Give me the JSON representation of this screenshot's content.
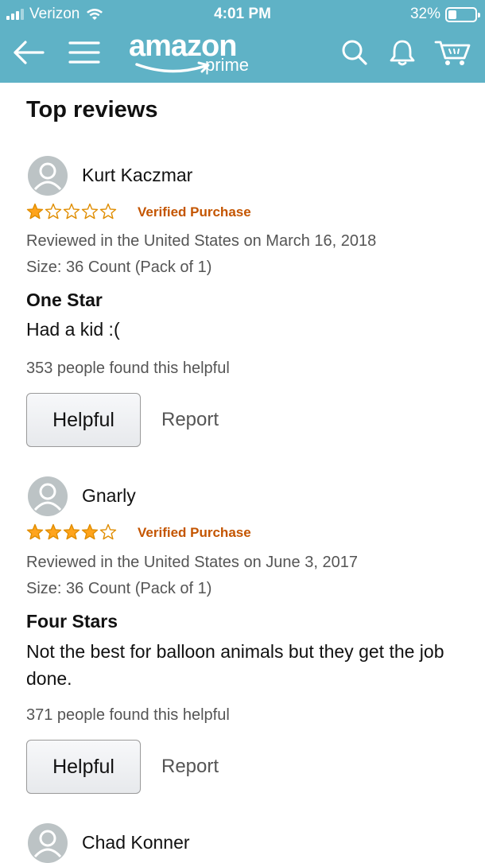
{
  "status_bar": {
    "carrier": "Verizon",
    "time": "4:01 PM",
    "battery": "32%",
    "battery_level": 0.32
  },
  "nav": {
    "logo_text": "amazon",
    "logo_subtext": "prime",
    "icons": [
      "back-arrow-icon",
      "menu-icon",
      "search-icon",
      "bell-icon",
      "cart-icon"
    ]
  },
  "section_title": "Top reviews",
  "reviews": [
    {
      "reviewer": "Kurt Kaczmar",
      "rating": 1,
      "verified": "Verified Purchase",
      "date": "Reviewed in the United States on March 16, 2018",
      "size": "Size: 36 Count (Pack of 1)",
      "title": "One Star",
      "body": "Had a kid :(",
      "helpful_count": "353 people found this helpful",
      "helpful_label": "Helpful",
      "report_label": "Report"
    },
    {
      "reviewer": "Gnarly",
      "rating": 4,
      "verified": "Verified Purchase",
      "date": "Reviewed in the United States on June 3, 2017",
      "size": "Size: 36 Count (Pack of 1)",
      "title": "Four Stars",
      "body": "Not the best for balloon animals but they get the job done.",
      "helpful_count": "371 people found this helpful",
      "helpful_label": "Helpful",
      "report_label": "Report"
    },
    {
      "reviewer": "Chad Konner"
    }
  ],
  "colors": {
    "header_bg": "#5fb2c6",
    "star_fill": "#ffa41c",
    "verified": "#c45500",
    "avatar_bg": "#bcc3c5"
  }
}
